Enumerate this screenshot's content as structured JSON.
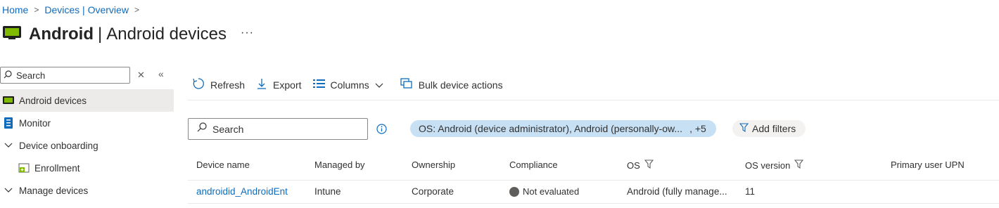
{
  "breadcrumb": {
    "home": "Home",
    "devices": "Devices | Overview"
  },
  "header": {
    "title_bold": "Android",
    "title_rest": "Android devices",
    "more": "···"
  },
  "sidebar": {
    "search_placeholder": "Search",
    "items": [
      {
        "label": "Android devices"
      },
      {
        "label": "Monitor"
      },
      {
        "label": "Device onboarding"
      },
      {
        "label": "Enrollment"
      },
      {
        "label": "Manage devices"
      }
    ]
  },
  "toolbar": {
    "refresh": "Refresh",
    "export": "Export",
    "columns": "Columns",
    "bulk": "Bulk device actions"
  },
  "filters": {
    "search_placeholder": "Search",
    "os_chip": "OS: Android (device administrator), Android (personally-ow...",
    "os_chip_more": ", +5",
    "add_filters": "Add filters"
  },
  "table": {
    "headers": [
      "Device name",
      "Managed by",
      "Ownership",
      "Compliance",
      "OS",
      "OS version",
      "Primary user UPN"
    ],
    "rows": [
      {
        "device_name": "androidid_AndroidEnt",
        "managed_by": "Intune",
        "ownership": "Corporate",
        "compliance": "Not evaluated",
        "os": "Android (fully manage...",
        "os_version": "11",
        "upn": ""
      }
    ]
  },
  "colors": {
    "accent": "#0f6cbd",
    "chip": "#c7e0f4",
    "active_nav": "#edebe9"
  }
}
